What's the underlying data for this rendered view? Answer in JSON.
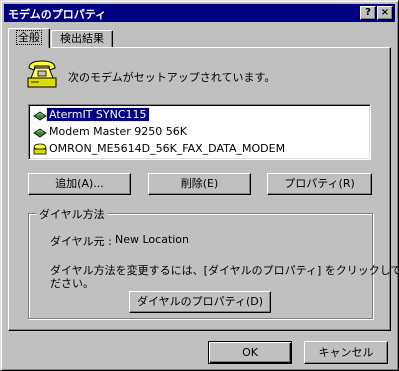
{
  "window": {
    "title": "モデムのプロパティ",
    "help_button": "?",
    "close_button": "×"
  },
  "tabs": [
    {
      "label": "全般",
      "active": true
    },
    {
      "label": "検出結果",
      "active": false
    }
  ],
  "general": {
    "intro_text": "次のモデムがセットアップされています。",
    "icons": {
      "header": "telephone-modem-icon",
      "item": "modem-icon"
    },
    "modems": [
      {
        "name": "AtermIT SYNC115",
        "selected": true
      },
      {
        "name": "Modem Master 9250 56K",
        "selected": false
      },
      {
        "name": "OMRON_ME5614D_56K_FAX_DATA_MODEM",
        "selected": false
      }
    ],
    "buttons": {
      "add": "追加(A)...",
      "remove": "削除(E)",
      "properties": "プロパティ(R)"
    },
    "dialing": {
      "group_label": "ダイヤル方法",
      "origin_label": "ダイヤル元 :",
      "origin_value": "New Location",
      "help_line1": "ダイヤル方法を変更するには、[ダイヤルのプロパティ] をクリックしてく",
      "help_line2": "ださい。",
      "dialing_properties_button": "ダイヤルのプロパティ(D)"
    }
  },
  "footer": {
    "ok": "OK",
    "cancel": "キャンセル"
  },
  "colors": {
    "face": "#c0c0c0",
    "titlebar": "#000080",
    "selection": "#000080"
  }
}
